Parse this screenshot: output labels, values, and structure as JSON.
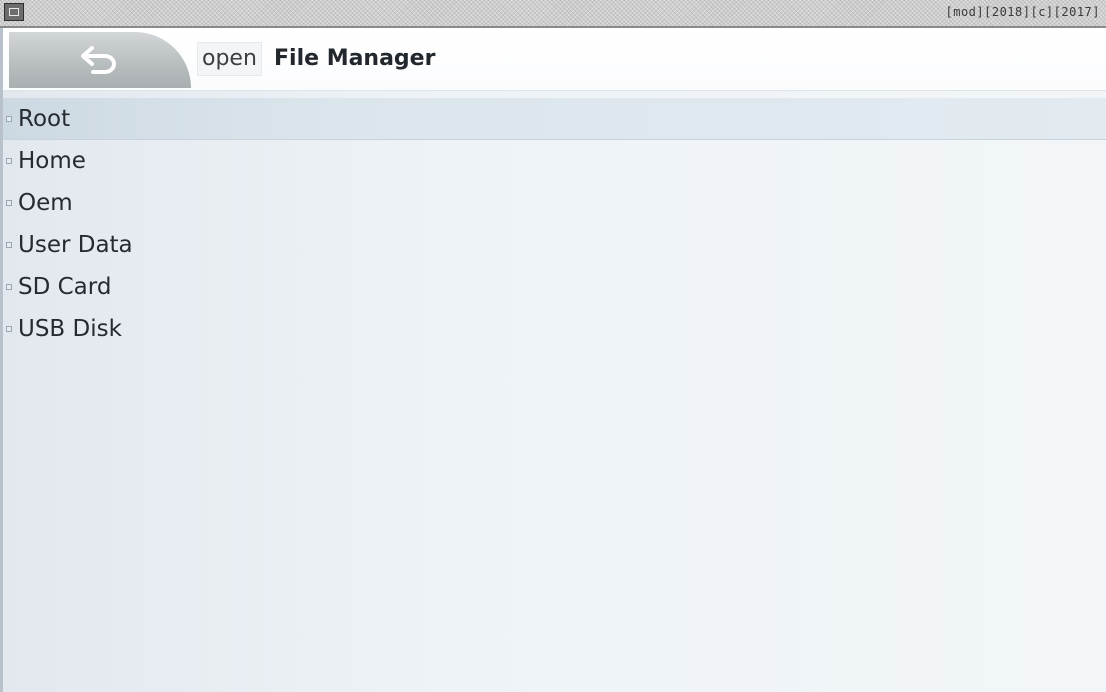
{
  "status_bar": {
    "app_icon": "terminal-window-icon",
    "text": "[mod][2018][c][2017]"
  },
  "header": {
    "back_icon": "undo-arrow-icon",
    "title_prefix": "open",
    "title": "File Manager"
  },
  "locations": [
    {
      "label": "Root",
      "selected": true
    },
    {
      "label": "Home",
      "selected": false
    },
    {
      "label": "Oem",
      "selected": false
    },
    {
      "label": "User Data",
      "selected": false
    },
    {
      "label": "SD Card",
      "selected": false
    },
    {
      "label": "USB Disk",
      "selected": false
    }
  ],
  "colors": {
    "background": "#eef2f6",
    "selected_row": "#d4dfe7",
    "back_button": "#b7bcbf",
    "text": "#262b30"
  }
}
